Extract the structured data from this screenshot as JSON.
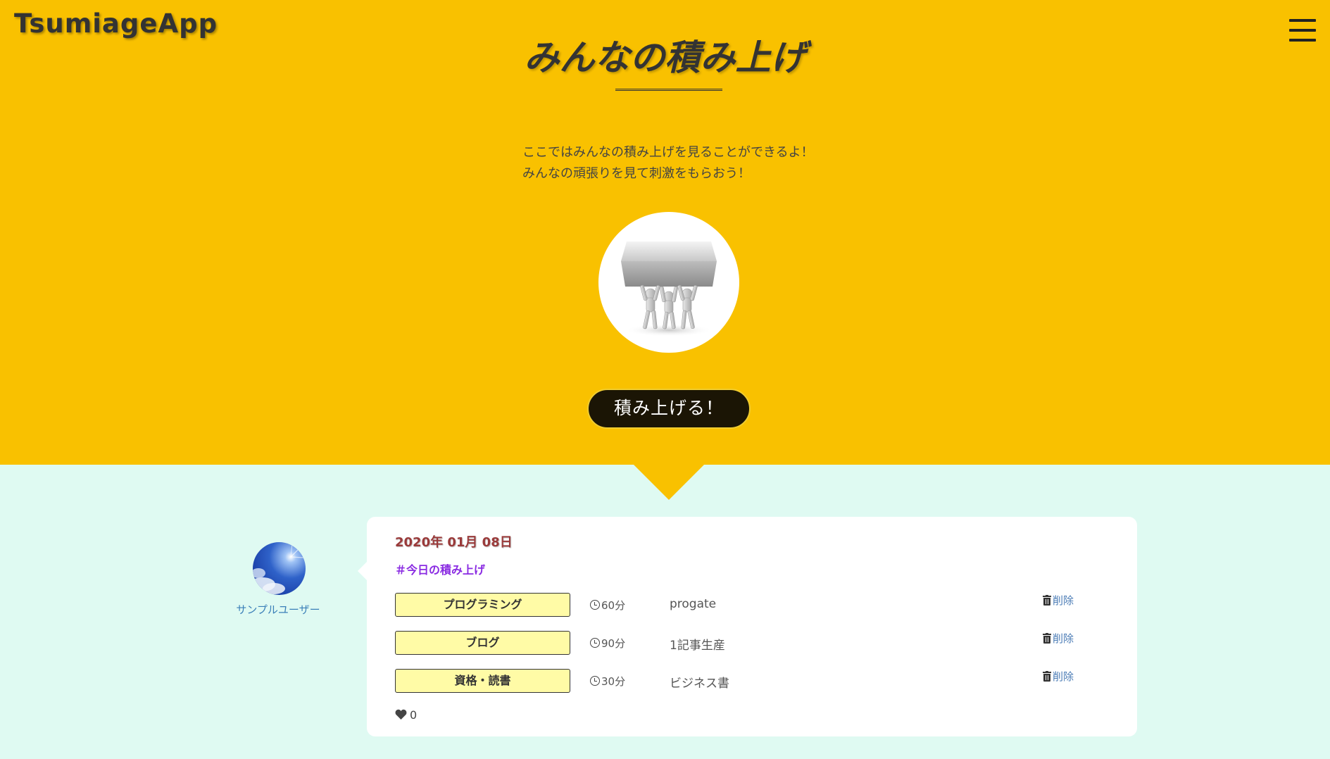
{
  "header": {
    "logo": "TsumiageApp",
    "menu_icon": "hamburger-menu-icon"
  },
  "hero": {
    "title": "みんなの積み上げ",
    "desc_line1": "ここではみんなの積み上げを見ることができるよ！",
    "desc_line2": "みんなの頑張りを見て刺激をもらおう！",
    "image_icon": "people-lifting-box-illustration",
    "button_label": "積み上げる！"
  },
  "post": {
    "username": "サンプルユーザー",
    "date": "2020年 01月 08日",
    "tag": "＃今日の積み上げ",
    "items": [
      {
        "category": "プログラミング",
        "minutes": "60分",
        "detail": "progate",
        "delete_label": "削除"
      },
      {
        "category": "ブログ",
        "minutes": "90分",
        "detail": "1記事生産",
        "delete_label": "削除"
      },
      {
        "category": "資格・読書",
        "minutes": "30分",
        "detail": "ビジネス書",
        "delete_label": "削除"
      }
    ],
    "likes": "0"
  },
  "colors": {
    "hero_bg": "#f9c100",
    "feed_bg": "#dffaf2",
    "button_bg": "#1b1505",
    "category_bg": "#fffba6",
    "date_color": "#9a3a3a",
    "tag_color": "#8a2be2",
    "link_color": "#4a7bb5"
  }
}
